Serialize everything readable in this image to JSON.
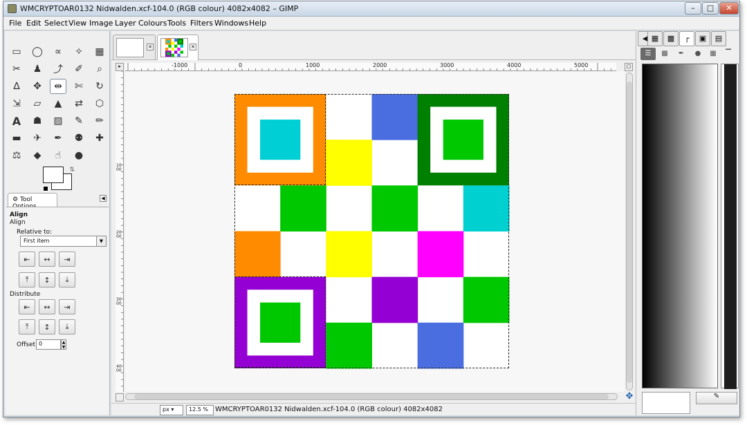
{
  "window": {
    "title": "WMCRYPTOAR0132 Nidwalden.xcf-104.0 (RGB colour) 4082x4082 – GIMP",
    "controls": {
      "minimize": "–",
      "maximize": "□",
      "close": "✕"
    }
  },
  "menu": [
    {
      "label": "File"
    },
    {
      "label": "Edit"
    },
    {
      "label": "Select"
    },
    {
      "label": "View"
    },
    {
      "label": "Image"
    },
    {
      "label": "Layer"
    },
    {
      "label": "Colours"
    },
    {
      "label": "Tools"
    },
    {
      "label": "Filters"
    },
    {
      "label": "Windows"
    },
    {
      "label": "Help"
    }
  ],
  "toolbox": {
    "tools": [
      "rect-select-icon",
      "ellipse-select-icon",
      "free-select-icon",
      "fuzzy-select-icon",
      "select-by-colour-icon",
      "scissors-select-icon",
      "foreground-select-icon",
      "paths-icon",
      "colour-picker-icon",
      "zoom-icon",
      "measure-icon",
      "move-icon",
      "align-icon",
      "crop-icon",
      "rotate-icon",
      "scale-icon",
      "shear-icon",
      "perspective-icon",
      "flip-icon",
      "cage-icon",
      "text-icon",
      "bucket-fill-icon",
      "blend-icon",
      "pencil-icon",
      "paintbrush-icon",
      "eraser-icon",
      "airbrush-icon",
      "ink-icon",
      "clone-icon",
      "heal-icon",
      "perspective-clone-icon",
      "blur-icon",
      "smudge-icon",
      "dodge-burn-icon"
    ],
    "glyphs": {
      "rect-select-icon": "▭",
      "ellipse-select-icon": "◯",
      "free-select-icon": "∝",
      "fuzzy-select-icon": "✧",
      "select-by-colour-icon": "▦",
      "scissors-select-icon": "✂",
      "foreground-select-icon": "♟",
      "paths-icon": "⤴",
      "colour-picker-icon": "✐",
      "zoom-icon": "⌕",
      "measure-icon": "∆",
      "move-icon": "✥",
      "align-icon": "⇹",
      "crop-icon": "✄",
      "rotate-icon": "↻",
      "scale-icon": "⇲",
      "shear-icon": "▱",
      "perspective-icon": "▲",
      "flip-icon": "⇄",
      "cage-icon": "⬡",
      "text-icon": "A",
      "bucket-fill-icon": "☗",
      "blend-icon": "▨",
      "pencil-icon": "✎",
      "paintbrush-icon": "✏",
      "eraser-icon": "▬",
      "airbrush-icon": "✈",
      "ink-icon": "✒",
      "clone-icon": "⚉",
      "heal-icon": "✚",
      "perspective-clone-icon": "⚖",
      "blur-icon": "◆",
      "smudge-icon": "☝",
      "dodge-burn-icon": "●"
    },
    "active_tool": "align-icon",
    "options_tab_label": "Tool Options",
    "options": {
      "heading": "Align",
      "subheading": "Align",
      "relative_label": "Relative to:",
      "relative_value": "First item",
      "distribute_label": "Distribute",
      "offset_label": "Offset:",
      "offset_value": "0"
    }
  },
  "image_window": {
    "tabs": [
      {
        "name": "empty-image"
      },
      {
        "name": "checker-image"
      }
    ],
    "ruler_h_labels": [
      "-1000",
      "0",
      "1000",
      "2000",
      "3000",
      "4000",
      "5000"
    ],
    "ruler_v_labels": [
      "1000",
      "2000",
      "3000",
      "4000"
    ],
    "unit": "px",
    "zoom": "12.5 %",
    "status": "WMCRYPTOAR0132 Nidwalden.xcf-104.0 (RGB colour) 4082x4082"
  },
  "artwork": {
    "grid_cols": 6,
    "grid_rows": 6,
    "cells": [
      [
        "orange-frame",
        "orange-frame",
        "white",
        "#4a6ee0",
        "green-frame",
        "green-frame"
      ],
      [
        "orange-frame",
        "orange-frame",
        "#ffff00",
        "white",
        "green-frame",
        "green-frame"
      ],
      [
        "white",
        "#00c800",
        "white",
        "#00c800",
        "white",
        "#00d0d0"
      ],
      [
        "#ff8c00",
        "white",
        "#ffff00",
        "white",
        "#ff00ff",
        "white"
      ],
      [
        "purple-frame",
        "purple-frame",
        "white",
        "#9400d3",
        "white",
        "#00c800"
      ],
      [
        "purple-frame",
        "purple-frame",
        "#00c800",
        "white",
        "#4a6ee0",
        "white"
      ]
    ],
    "frames": [
      {
        "name": "orange-frame-block",
        "outer": "#ff8c00",
        "inner": "#00cfd6",
        "row": 0,
        "col": 0
      },
      {
        "name": "green-frame-block",
        "outer": "#008000",
        "inner": "#00c800",
        "row": 0,
        "col": 4
      },
      {
        "name": "purple-frame-block",
        "outer": "#9400d3",
        "inner": "#00c800",
        "row": 4,
        "col": 0
      }
    ]
  },
  "docks": {
    "tabs": [
      "patterns-icon",
      "brushes-icon",
      "dock-pointer-icon",
      "gradients-icon",
      "palettes-icon"
    ],
    "icons": [
      "layers-icon",
      "channels-icon",
      "paths-dock-icon",
      "undo-icon",
      "colourmap-icon",
      "histogram-icon",
      "dock-menu-icon"
    ]
  }
}
